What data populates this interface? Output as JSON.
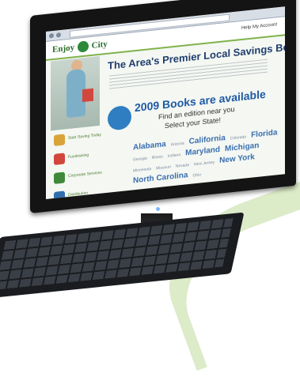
{
  "site": {
    "logo_text_left": "Enjoy",
    "logo_text_right": "City",
    "header_links": "Help  My Account",
    "headline": "The Area's Premier Local Savings Book!",
    "books_title": "2009 Books are available",
    "books_sub_1": "Find an edition near you",
    "books_sub_2": "Select your State!",
    "states": [
      {
        "name": "Alabama",
        "size": "big"
      },
      {
        "name": "Arizona",
        "size": "small"
      },
      {
        "name": "California",
        "size": "big"
      },
      {
        "name": "Colorado",
        "size": "small"
      },
      {
        "name": "Florida",
        "size": "big"
      },
      {
        "name": "Georgia",
        "size": "small"
      },
      {
        "name": "Illinois",
        "size": "small"
      },
      {
        "name": "Indiana",
        "size": "small"
      },
      {
        "name": "Maryland",
        "size": "big"
      },
      {
        "name": "Michigan",
        "size": "big"
      },
      {
        "name": "Minnesota",
        "size": "small"
      },
      {
        "name": "Missouri",
        "size": "small"
      },
      {
        "name": "Nevada",
        "size": "small"
      },
      {
        "name": "New Jersey",
        "size": "small"
      },
      {
        "name": "New York",
        "size": "big"
      },
      {
        "name": "North Carolina",
        "size": "big"
      },
      {
        "name": "Ohio",
        "size": "small"
      }
    ],
    "sidebar": [
      {
        "label": "Start Saving Today",
        "color": "#d9a33a"
      },
      {
        "label": "Fundraising",
        "color": "#d3463e"
      },
      {
        "label": "Corporate Services",
        "color": "#3f8a3a"
      },
      {
        "label": "Distribution",
        "color": "#2f6fb0"
      }
    ]
  }
}
